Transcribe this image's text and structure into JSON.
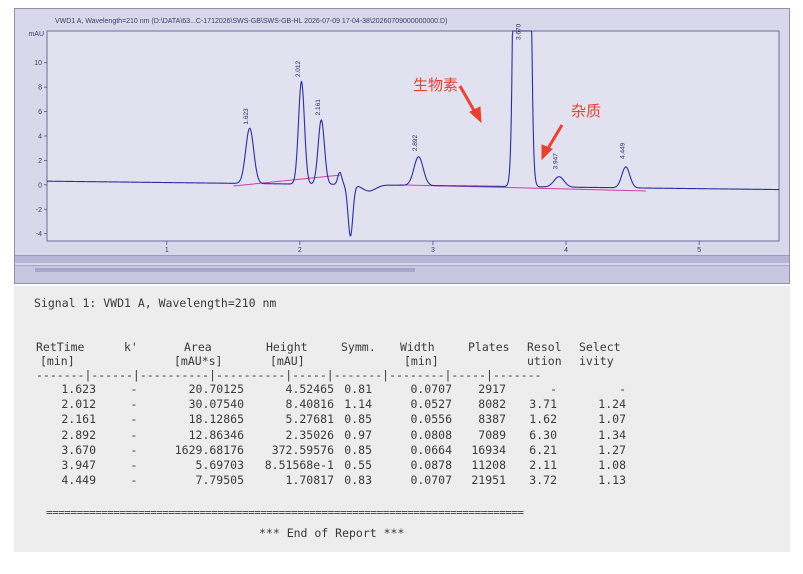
{
  "screen": {
    "title": "VWD1 A, Wavelength=210 nm (D:\\DATA\\63...C-1712026\\SWS-GB\\SWS-GB-HL 2026-07-09 17-04-38\\20260709000000000.D)",
    "y_unit": "mAU"
  },
  "annotations": {
    "biotin": "生物素",
    "impurity": "杂质"
  },
  "chart_data": {
    "type": "line",
    "title": "",
    "xlabel": "",
    "ylabel": "mAU",
    "xlim": [
      0.1,
      5.6
    ],
    "ylim": [
      -4.6,
      12.6
    ],
    "x_ticks": [
      1,
      2,
      3,
      4,
      5
    ],
    "y_ticks": [
      -4,
      -2,
      0,
      2,
      4,
      6,
      8,
      10
    ],
    "grid": false,
    "baseline": 0,
    "peaks": [
      {
        "rt": 1.623,
        "label": "1.623",
        "height": 4.52465,
        "width": 0.0707
      },
      {
        "rt": 2.012,
        "label": "2.012",
        "height": 8.40816,
        "width": 0.0527
      },
      {
        "rt": 2.161,
        "label": "2.161",
        "height": 5.27681,
        "width": 0.0556
      },
      {
        "rt": 2.892,
        "label": "2.892",
        "height": 2.35026,
        "width": 0.0808
      },
      {
        "rt": 3.67,
        "label": "3.670",
        "height": 372.59576,
        "width": 0.0664
      },
      {
        "rt": 3.947,
        "label": "3.947",
        "height": 0.851568,
        "width": 0.0878
      },
      {
        "rt": 4.449,
        "label": "4.449",
        "height": 1.70817,
        "width": 0.0707
      }
    ]
  },
  "report": {
    "signal_line": "Signal 1: VWD1 A, Wavelength=210 nm",
    "headers_1": [
      "RetTime",
      "k'",
      "Area",
      "Height",
      "Symm.",
      "Width",
      "Plates",
      "Resol",
      "Select"
    ],
    "headers_2": [
      "[min]",
      "",
      "[mAU*s]",
      "[mAU]",
      "",
      "[min]",
      "",
      "ution",
      "ivity"
    ],
    "separator": "-------|------|----------|----------|-----|-------|--------|-----|-------",
    "rows": [
      [
        "1.623",
        "-",
        "20.70125",
        "4.52465",
        "0.81",
        "0.0707",
        "2917",
        "-",
        "-"
      ],
      [
        "2.012",
        "-",
        "30.07540",
        "8.40816",
        "1.14",
        "0.0527",
        "8082",
        "3.71",
        "1.24"
      ],
      [
        "2.161",
        "-",
        "18.12865",
        "5.27681",
        "0.85",
        "0.0556",
        "8387",
        "1.62",
        "1.07"
      ],
      [
        "2.892",
        "-",
        "12.86346",
        "2.35026",
        "0.97",
        "0.0808",
        "7089",
        "6.30",
        "1.34"
      ],
      [
        "3.670",
        "-",
        "1629.68176",
        "372.59576",
        "0.85",
        "0.0664",
        "16934",
        "6.21",
        "1.27"
      ],
      [
        "3.947",
        "-",
        "5.69703",
        "8.51568e-1",
        "0.55",
        "0.0878",
        "11208",
        "2.11",
        "1.08"
      ],
      [
        "4.449",
        "-",
        "7.79505",
        "1.70817",
        "0.83",
        "0.0707",
        "21951",
        "3.72",
        "1.13"
      ]
    ],
    "rule": "==============================================================================",
    "end": "*** End of Report ***"
  }
}
